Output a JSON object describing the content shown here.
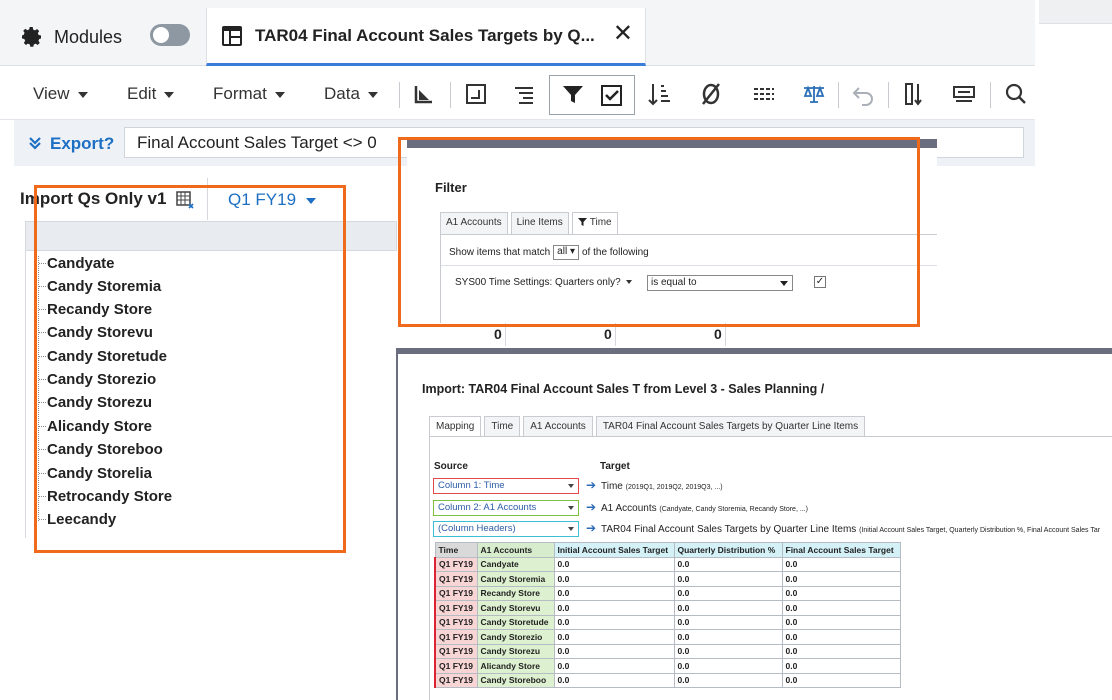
{
  "tabs": {
    "modules_label": "Modules",
    "active_tab_label": "TAR04 Final Account Sales Targets by Q..."
  },
  "toolbar": {
    "menus": [
      "View",
      "Edit",
      "Format",
      "Data"
    ]
  },
  "export": {
    "link_label": "Export?",
    "filter_text": "Final Account Sales Target <> 0"
  },
  "grid": {
    "title": "Import Qs Only v1",
    "period": "Q1 FY19",
    "rows": [
      "Candyate",
      "Candy Storemia",
      "Recandy Store",
      "Candy Storevu",
      "Candy Storetude",
      "Candy Storezio",
      "Candy Storezu",
      "Alicandy Store",
      "Candy Storeboo",
      "Candy Storelia",
      "Retrocandy Store",
      "Leecandy"
    ],
    "zeros": [
      "0",
      "0",
      "0"
    ]
  },
  "filter_dialog": {
    "title": "Filter",
    "tabs": [
      "A1 Accounts",
      "Line Items",
      "Time"
    ],
    "match_prefix": "Show items that match",
    "match_value": "all",
    "match_suffix": "of the following",
    "condition_field": "SYS00 Time Settings: Quarters only?",
    "operator": "is equal to",
    "value_checked": "✓"
  },
  "import_dialog": {
    "title": "Import: TAR04 Final Account Sales T from Level 3 - Sales Planning /",
    "tabs": [
      "Mapping",
      "Time",
      "A1 Accounts",
      "TAR04 Final Account Sales Targets by Quarter Line Items"
    ],
    "source_label": "Source",
    "target_label": "Target",
    "mappings": [
      {
        "source": "Column 1: Time",
        "target": "Time",
        "target_detail": "(2019Q1, 2019Q2, 2019Q3, ...)",
        "color": "#e04a4a"
      },
      {
        "source": "Column 2: A1 Accounts",
        "target": "A1 Accounts",
        "target_detail": "(Candyate, Candy Storemia, Recandy Store, ...)",
        "color": "#7ac143"
      },
      {
        "source": "(Column Headers)",
        "target": "TAR04 Final Account Sales Targets by Quarter Line Items",
        "target_detail": "(Initial Account Sales Target, Quarterly Distribution %, Final Account Sales Tar",
        "color": "#3bbfd6"
      }
    ],
    "table": {
      "headers": [
        "Time",
        "A1 Accounts",
        "Initial Account Sales Target",
        "Quarterly Distribution %",
        "Final Account Sales Target"
      ],
      "rows": [
        [
          "Q1 FY19",
          "Candyate",
          "0.0",
          "0.0",
          "0.0"
        ],
        [
          "Q1 FY19",
          "Candy Storemia",
          "0.0",
          "0.0",
          "0.0"
        ],
        [
          "Q1 FY19",
          "Recandy Store",
          "0.0",
          "0.0",
          "0.0"
        ],
        [
          "Q1 FY19",
          "Candy Storevu",
          "0.0",
          "0.0",
          "0.0"
        ],
        [
          "Q1 FY19",
          "Candy Storetude",
          "0.0",
          "0.0",
          "0.0"
        ],
        [
          "Q1 FY19",
          "Candy Storezio",
          "0.0",
          "0.0",
          "0.0"
        ],
        [
          "Q1 FY19",
          "Candy Storezu",
          "0.0",
          "0.0",
          "0.0"
        ],
        [
          "Q1 FY19",
          "Alicandy Store",
          "0.0",
          "0.0",
          "0.0"
        ],
        [
          "Q1 FY19",
          "Candy Storeboo",
          "0.0",
          "0.0",
          "0.0"
        ]
      ]
    }
  },
  "colors": {
    "accent": "#1d6fc4",
    "highlight": "#f06a1b",
    "dialog_border": "#6a6e7f"
  }
}
